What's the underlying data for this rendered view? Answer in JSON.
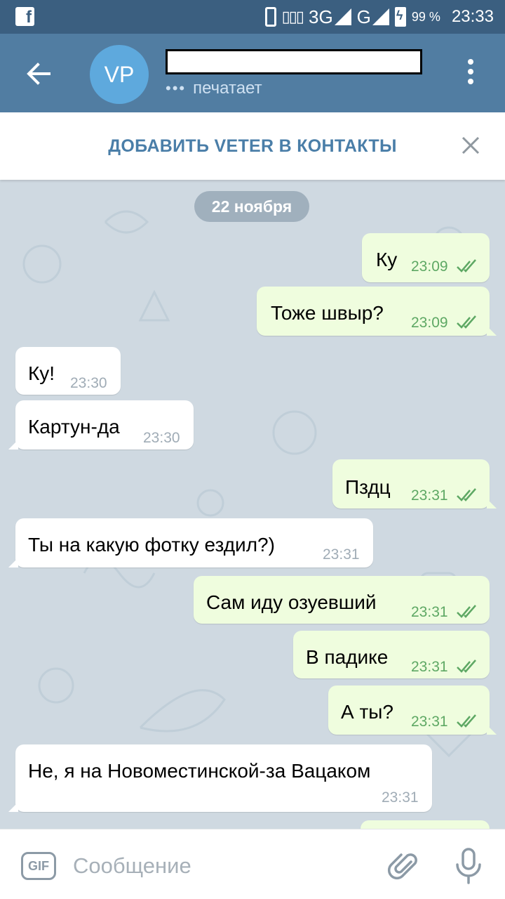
{
  "status_bar": {
    "network_1": "3G",
    "network_2": "G",
    "battery": "99 %",
    "time": "23:33"
  },
  "header": {
    "avatar_initials": "VP",
    "status": "печатает"
  },
  "add_contact": {
    "label": "ДОБАВИТЬ VETER В КОНТАКТЫ"
  },
  "date_separator": "22 ноября",
  "messages": [
    {
      "dir": "out",
      "text": "Ку",
      "time": "23:09"
    },
    {
      "dir": "out",
      "text": "Тоже швыр?",
      "time": "23:09"
    },
    {
      "dir": "in",
      "text": "Ку!",
      "time": "23:30"
    },
    {
      "dir": "in",
      "text": "Картун-да",
      "time": "23:30"
    },
    {
      "dir": "out",
      "text": "Пздц",
      "time": "23:31"
    },
    {
      "dir": "in",
      "text": "Ты на какую фотку ездил?)",
      "time": "23:31"
    },
    {
      "dir": "out",
      "text": "Сам иду озуевший",
      "time": "23:31"
    },
    {
      "dir": "out",
      "text": "В падике",
      "time": "23:31"
    },
    {
      "dir": "out",
      "text": "А ты?",
      "time": "23:31"
    },
    {
      "dir": "in",
      "text": "Не, я на Новоместинской-за Вацаком",
      "time": "23:31"
    }
  ],
  "composer": {
    "gif_label": "GIF",
    "placeholder": "Сообщение"
  },
  "colors": {
    "header": "#517da2",
    "status_bar": "#3b5f80",
    "out_bubble": "#effdde",
    "in_bubble": "#ffffff",
    "accent_text": "#4a7ea8",
    "check": "#5ea864"
  }
}
